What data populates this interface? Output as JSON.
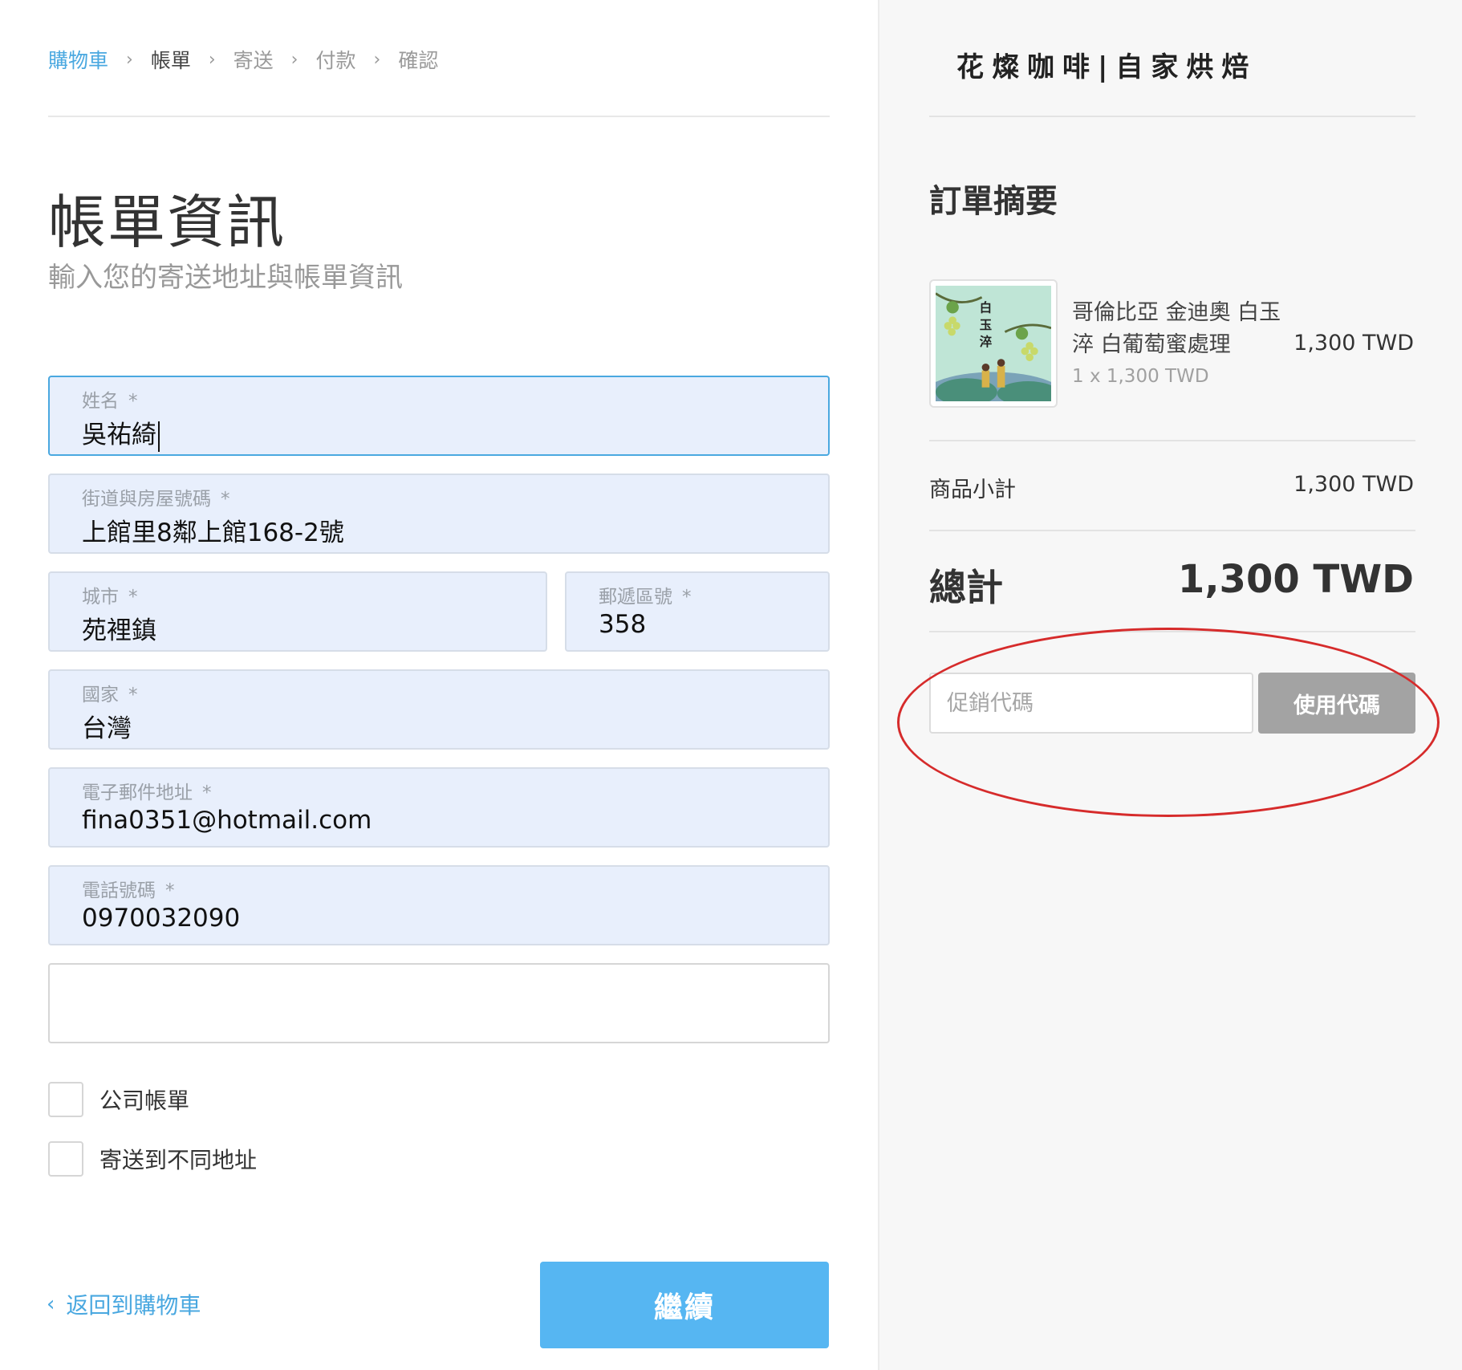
{
  "breadcrumb": {
    "items": [
      "購物車",
      "帳單",
      "寄送",
      "付款",
      "確認"
    ],
    "separator": "›"
  },
  "page": {
    "title": "帳單資訊",
    "subtitle": "輸入您的寄送地址與帳單資訊"
  },
  "form": {
    "required_mark": "*",
    "name": {
      "label": "姓名",
      "value": "吳祐綺"
    },
    "street": {
      "label": "街道與房屋號碼",
      "value": "上館里8鄰上館168-2號"
    },
    "city": {
      "label": "城市",
      "value": "苑裡鎮"
    },
    "postal": {
      "label": "郵遞區號",
      "value": "358"
    },
    "country": {
      "label": "國家",
      "value": "台灣"
    },
    "email": {
      "label": "電子郵件地址",
      "value": "fina0351@hotmail.com"
    },
    "phone": {
      "label": "電話號碼",
      "value": "0970032090"
    },
    "extra": {
      "value": ""
    },
    "checkbox_company": {
      "label": "公司帳單",
      "checked": false
    },
    "checkbox_other_address": {
      "label": "寄送到不同地址",
      "checked": false
    }
  },
  "actions": {
    "back_label": "返回到購物車",
    "continue_label": "繼續"
  },
  "summary": {
    "brand": "花燦咖啡|自家烘焙",
    "title": "訂單摘要",
    "item": {
      "name": "哥倫比亞 金迪奧 白玉淬 白葡萄蜜處理",
      "qty_line": "1 x 1,300 TWD",
      "price": "1,300 TWD",
      "image_text": [
        "白",
        "玉",
        "淬"
      ]
    },
    "subtotal_label": "商品小計",
    "subtotal_value": "1,300 TWD",
    "total_label": "總計",
    "total_value": "1,300 TWD",
    "promo_placeholder": "促銷代碼",
    "promo_button": "使用代碼"
  },
  "colors": {
    "accent": "#4aa8e0",
    "button": "#56b6f2",
    "field_bg": "#e8effc",
    "annotation": "#d62b2b"
  }
}
